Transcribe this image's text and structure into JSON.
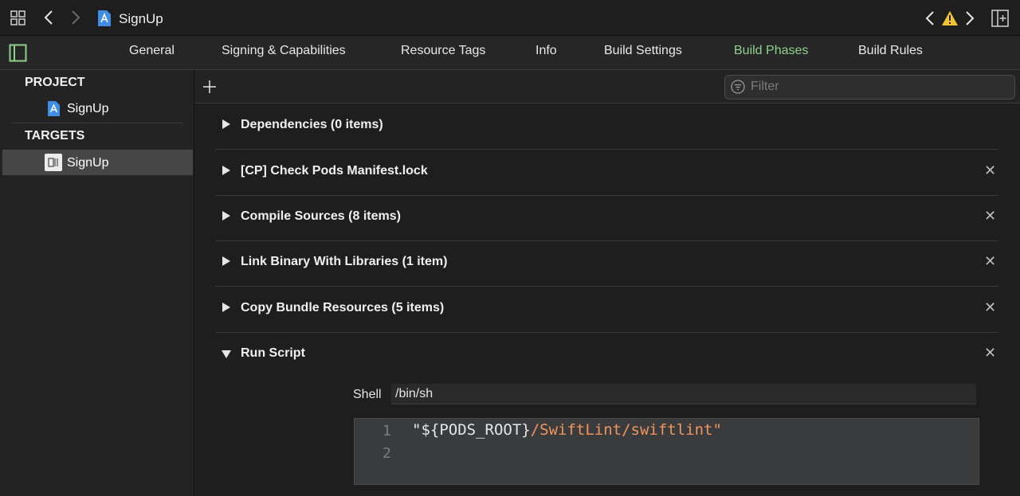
{
  "window": {
    "title": "SignUp"
  },
  "tabs": [
    "General",
    "Signing & Capabilities",
    "Resource Tags",
    "Info",
    "Build Settings",
    "Build Phases",
    "Build Rules"
  ],
  "sidebar": {
    "project_header": "PROJECT",
    "project_item": "SignUp",
    "targets_header": "TARGETS",
    "target_item": "SignUp"
  },
  "filter": {
    "placeholder": "Filter"
  },
  "phases": [
    "Dependencies (0 items)",
    "[CP] Check Pods Manifest.lock",
    "Compile Sources (8 items)",
    "Link Binary With Libraries (1 item)",
    "Copy Bundle Resources (5 items)",
    "Run Script"
  ],
  "run_script": {
    "shell_label": "Shell",
    "shell_value": "/bin/sh",
    "line_numbers": [
      "1",
      "2"
    ],
    "code_part1": "\"${PODS_ROOT}",
    "code_part2": "/SwiftLint/swiftlint\""
  },
  "colors": {
    "accent": "#8fd18c",
    "warning": "#f4c431",
    "string": "#f0955f"
  }
}
